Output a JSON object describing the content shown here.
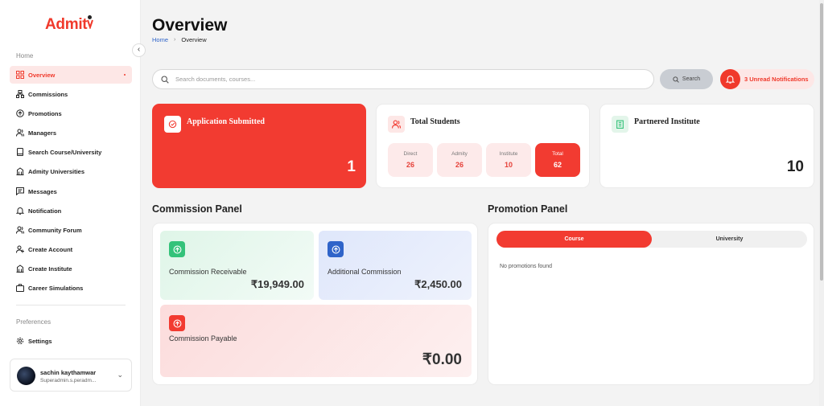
{
  "brand": {
    "name": "Admit"
  },
  "sidebar": {
    "section_main": "Home",
    "items": [
      {
        "label": "Overview",
        "icon": "grid-icon",
        "active": true
      },
      {
        "label": "Commissions",
        "icon": "network-icon"
      },
      {
        "label": "Promotions",
        "icon": "arrow-circle-icon"
      },
      {
        "label": "Managers",
        "icon": "users-icon"
      },
      {
        "label": "Search Course/University",
        "icon": "book-icon"
      },
      {
        "label": "Admity Universities",
        "icon": "building-icon"
      },
      {
        "label": "Messages",
        "icon": "message-icon"
      },
      {
        "label": "Notification",
        "icon": "bell-icon"
      },
      {
        "label": "Community Forum",
        "icon": "users-icon"
      },
      {
        "label": "Create Account",
        "icon": "user-plus-icon"
      },
      {
        "label": "Create Institute",
        "icon": "building-icon"
      },
      {
        "label": "Career Simulations",
        "icon": "briefcase-icon"
      }
    ],
    "section_prefs": "Preferences",
    "settings_label": "Settings"
  },
  "user": {
    "name": "sachin kaythamwar",
    "email": "Superadmin.s.peradm..."
  },
  "header": {
    "title": "Overview",
    "breadcrumb": {
      "home": "Home",
      "current": "Overview"
    }
  },
  "search": {
    "placeholder": "Search documents, courses...",
    "button_label": "Search"
  },
  "notifications": {
    "label": "3 Unread Notifications"
  },
  "stats": {
    "application": {
      "title": "Application Submitted",
      "value": "1"
    },
    "students": {
      "title": "Total Students",
      "breakdown": [
        {
          "label": "Direct",
          "value": "26"
        },
        {
          "label": "Admity",
          "value": "26"
        },
        {
          "label": "Institute",
          "value": "10"
        },
        {
          "label": "Total",
          "value": "62"
        }
      ]
    },
    "institute": {
      "title": "Partnered Institute",
      "value": "10"
    }
  },
  "commission_panel": {
    "title": "Commission Panel",
    "receivable": {
      "label": "Commission Receivable",
      "value": "₹19,949.00"
    },
    "additional": {
      "label": "Additional Commission",
      "value": "₹2,450.00"
    },
    "payable": {
      "label": "Commission Payable",
      "value": "₹0.00"
    }
  },
  "promotion_panel": {
    "title": "Promotion Panel",
    "tabs": [
      "Course",
      "University"
    ],
    "active_tab": "Course",
    "empty_message": "No promotions found"
  },
  "colors": {
    "accent": "#f23b31",
    "link": "#2f64c9",
    "green": "#34c27a",
    "blue": "#2f64c9"
  }
}
